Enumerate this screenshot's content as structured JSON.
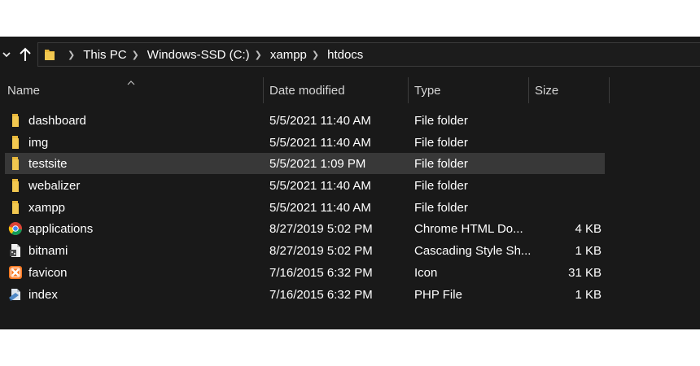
{
  "address_bar": {
    "crumbs": [
      "This PC",
      "Windows-SSD (C:)",
      "xampp",
      "htdocs"
    ]
  },
  "columns": {
    "name": "Name",
    "date": "Date modified",
    "type": "Type",
    "size": "Size"
  },
  "files": [
    {
      "name": "dashboard",
      "date": "5/5/2021 11:40 AM",
      "type": "File folder",
      "size": "",
      "icon": "folder-icon"
    },
    {
      "name": "img",
      "date": "5/5/2021 11:40 AM",
      "type": "File folder",
      "size": "",
      "icon": "folder-icon"
    },
    {
      "name": "testsite",
      "date": "5/5/2021 1:09 PM",
      "type": "File folder",
      "size": "",
      "icon": "folder-icon"
    },
    {
      "name": "webalizer",
      "date": "5/5/2021 11:40 AM",
      "type": "File folder",
      "size": "",
      "icon": "folder-icon"
    },
    {
      "name": "xampp",
      "date": "5/5/2021 11:40 AM",
      "type": "File folder",
      "size": "",
      "icon": "folder-icon"
    },
    {
      "name": "applications",
      "date": "8/27/2019 5:02 PM",
      "type": "Chrome HTML Do...",
      "size": "4 KB",
      "icon": "chrome-icon"
    },
    {
      "name": "bitnami",
      "date": "8/27/2019 5:02 PM",
      "type": "Cascading Style Sh...",
      "size": "1 KB",
      "icon": "css-file-icon"
    },
    {
      "name": "favicon",
      "date": "7/16/2015 6:32 PM",
      "type": "Icon",
      "size": "31 KB",
      "icon": "xampp-icon"
    },
    {
      "name": "index",
      "date": "7/16/2015 6:32 PM",
      "type": "PHP File",
      "size": "1 KB",
      "icon": "php-file-icon"
    }
  ],
  "selected_item": "testsite",
  "colors": {
    "background": "#191919",
    "selection": "#383838",
    "folder": "#e8b73a"
  }
}
